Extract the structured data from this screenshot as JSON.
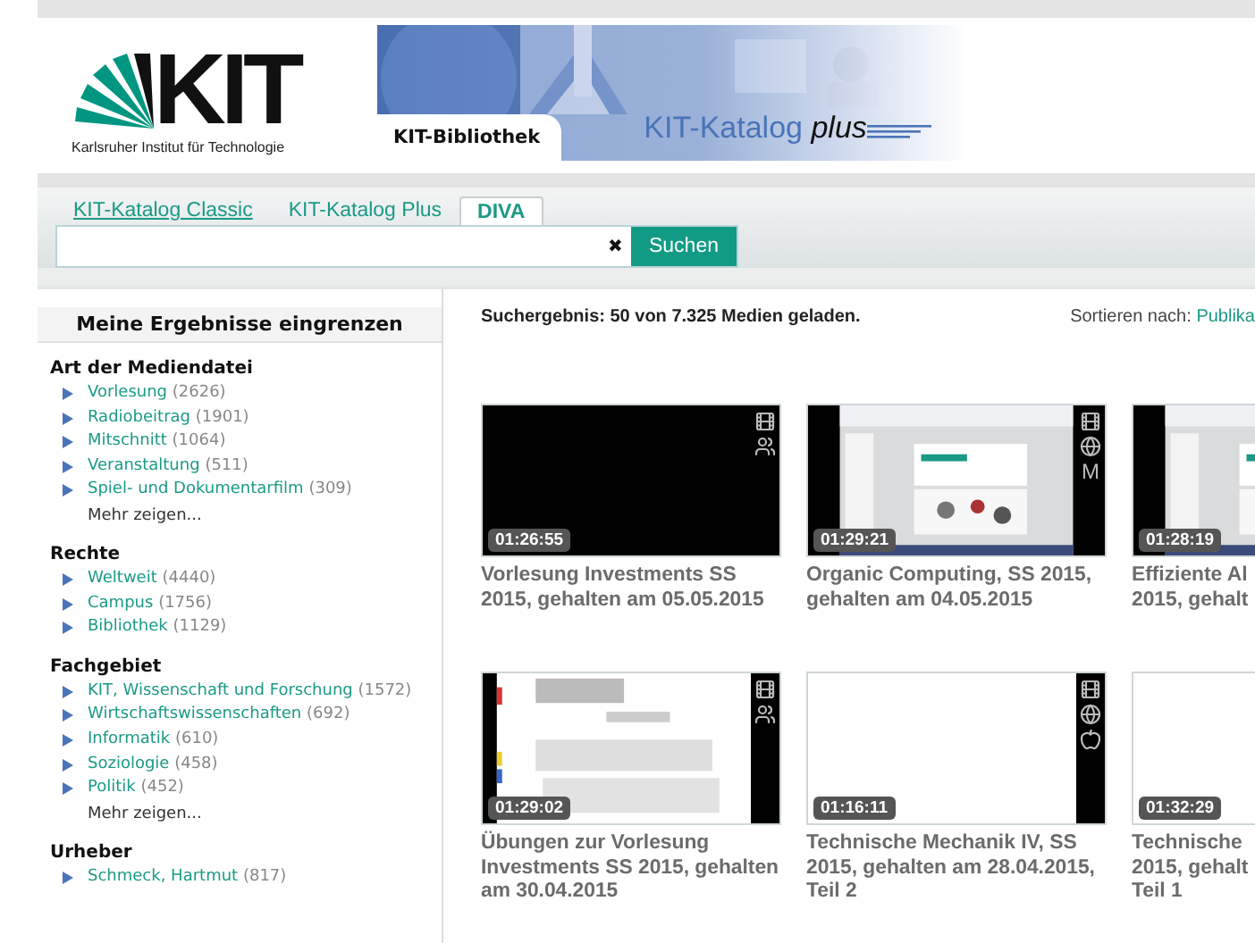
{
  "header": {
    "logo_text": "KIT",
    "institute": "Karlsruher Institut für Technologie",
    "banner_tab": "KIT-Bibliothek",
    "brand": "KIT-Katalog",
    "brand_suffix": "plus"
  },
  "tabs": [
    {
      "label": "KIT-Katalog Classic",
      "underlined": true,
      "selected": false
    },
    {
      "label": "KIT-Katalog Plus",
      "underlined": false,
      "selected": false
    },
    {
      "label": "DIVA",
      "underlined": false,
      "selected": true
    }
  ],
  "search": {
    "clear": "✖",
    "button": "Suchen"
  },
  "sidebar": {
    "title": "Meine Ergebnisse eingrenzen",
    "groups": [
      {
        "title": "Art der Mediendatei",
        "items": [
          {
            "label": "Vorlesung",
            "count": "(2626)"
          },
          {
            "label": "Radiobeitrag",
            "count": "(1901)"
          },
          {
            "label": "Mitschnitt",
            "count": "(1064)"
          },
          {
            "label": "Veranstaltung",
            "count": "(511)"
          },
          {
            "label": "Spiel- und Dokumentarfilm",
            "count": "(309)"
          }
        ],
        "more": "Mehr zeigen..."
      },
      {
        "title": "Rechte",
        "items": [
          {
            "label": "Weltweit",
            "count": "(4440)"
          },
          {
            "label": "Campus",
            "count": "(1756)"
          },
          {
            "label": "Bibliothek",
            "count": "(1129)"
          }
        ]
      },
      {
        "title": "Fachgebiet",
        "items": [
          {
            "label": "KIT, Wissenschaft und Forschung",
            "count": "(1572)"
          },
          {
            "label": "Wirtschaftswissenschaften",
            "count": "(692)"
          },
          {
            "label": "Informatik",
            "count": "(610)"
          },
          {
            "label": "Soziologie",
            "count": "(458)"
          },
          {
            "label": "Politik",
            "count": "(452)"
          }
        ],
        "more": "Mehr zeigen..."
      },
      {
        "title": "Urheber",
        "items": [
          {
            "label": "Schmeck, Hartmut",
            "count": "(817)"
          }
        ]
      }
    ]
  },
  "results": {
    "summary": "Suchergebnis: 50 von 7.325 Medien geladen.",
    "sort_label": "Sortieren nach:",
    "sort_value": "Publika",
    "cards": [
      {
        "kind": "black",
        "duration": "01:26:55",
        "badges": [
          {
            "kind": "film"
          },
          {
            "kind": "people"
          }
        ],
        "title_lines": [
          "Vorlesung Investments SS",
          "2015, gehalten am 05.05.2015"
        ]
      },
      {
        "kind": "slides",
        "duration": "01:29:21",
        "badges": [
          {
            "kind": "film"
          },
          {
            "kind": "globe"
          },
          {
            "kind": "letter",
            "text": "M"
          }
        ],
        "title_lines": [
          "Organic Computing, SS 2015,",
          "gehalten am 04.05.2015"
        ]
      },
      {
        "kind": "slides",
        "duration": "01:28:19",
        "title_lines": [
          "Effiziente Al",
          "2015, gehalt"
        ]
      },
      {
        "kind": "document",
        "duration": "01:29:02",
        "badges": [
          {
            "kind": "film"
          },
          {
            "kind": "people"
          }
        ],
        "title_lines": [
          "Übungen zur Vorlesung",
          "Investments SS 2015, gehalten",
          "am 30.04.2015"
        ]
      },
      {
        "kind": "blank",
        "duration": "01:16:11",
        "badges": [
          {
            "kind": "film"
          },
          {
            "kind": "globe"
          },
          {
            "kind": "apple"
          }
        ],
        "title_lines": [
          "Technische Mechanik IV, SS",
          "2015, gehalten am 28.04.2015,",
          "Teil 2"
        ]
      },
      {
        "kind": "blank",
        "duration": "01:32:29",
        "title_lines": [
          "Technische",
          "2015, gehalt",
          "Teil 1"
        ]
      }
    ]
  }
}
